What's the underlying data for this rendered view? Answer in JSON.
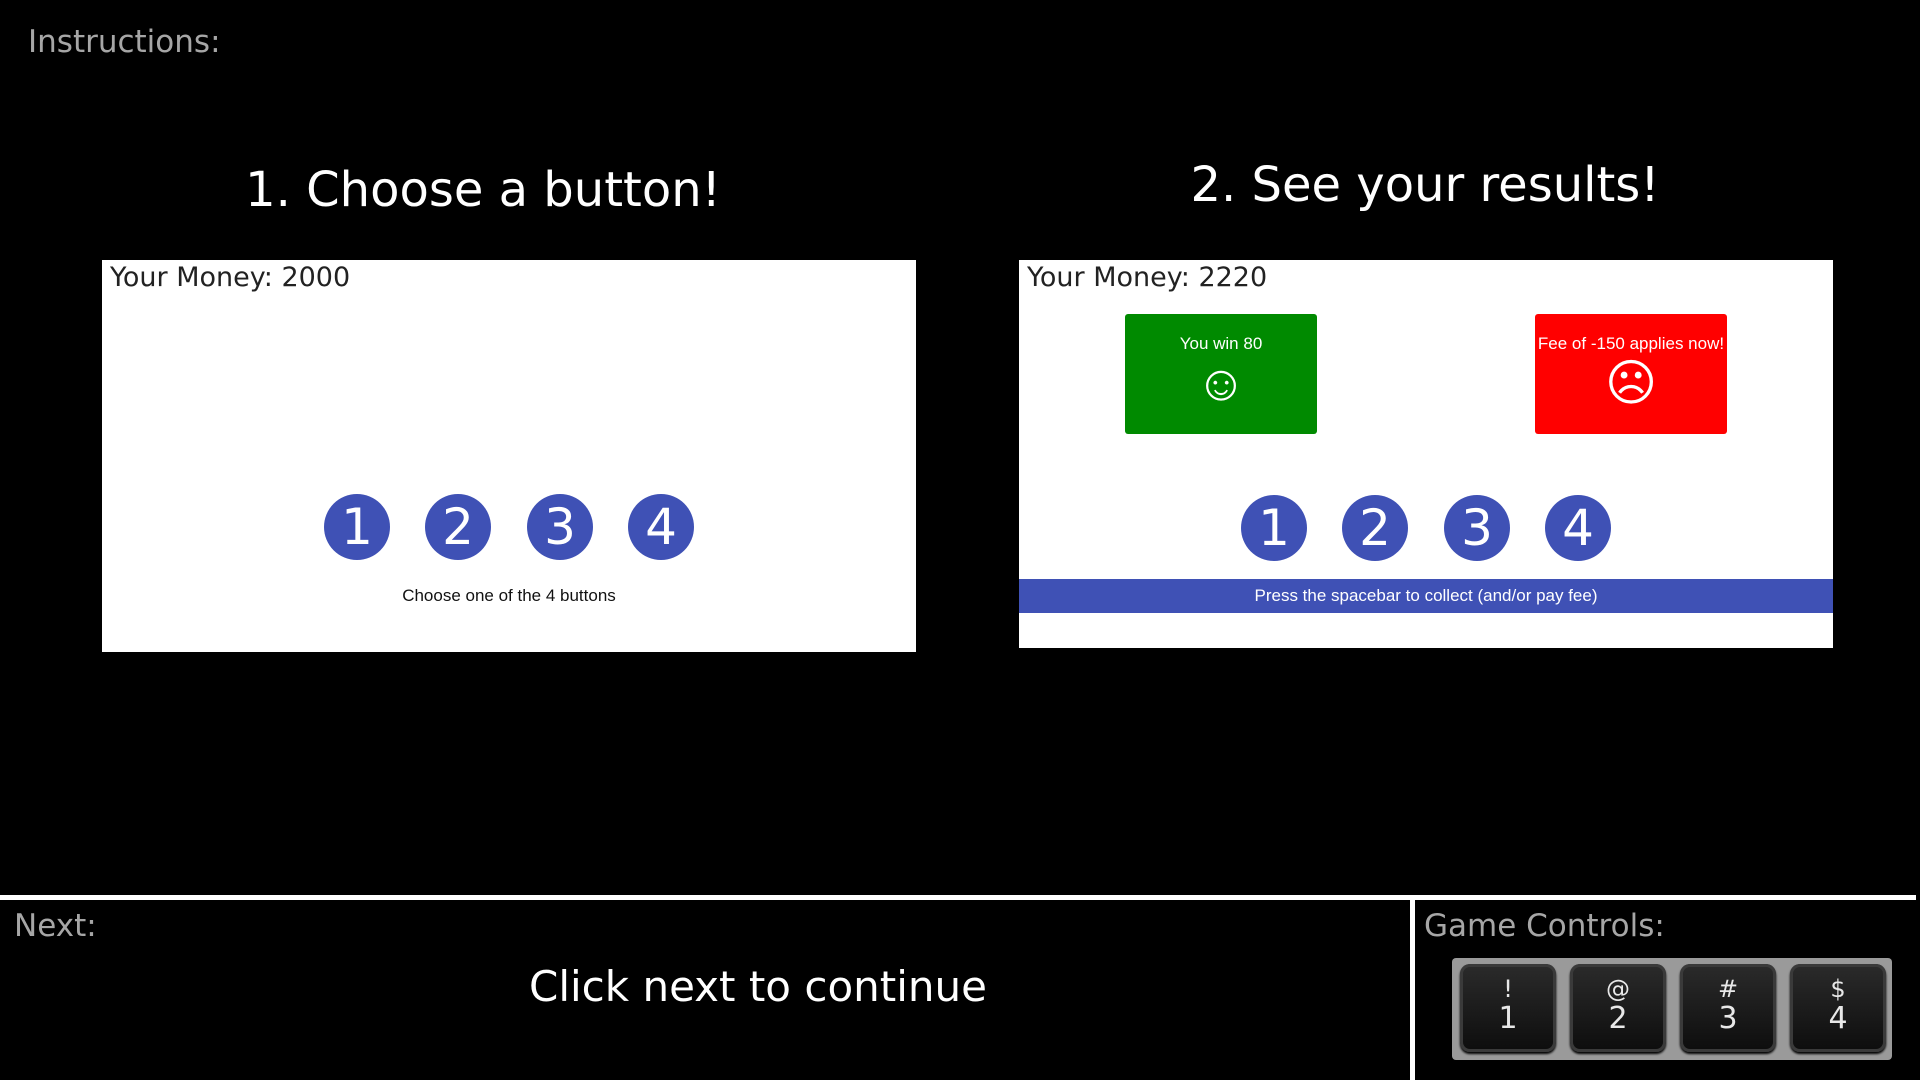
{
  "instructions_label": "Instructions:",
  "step1": {
    "title": "1. Choose a button!",
    "money_label": "Your Money: 2000",
    "buttons": [
      "1",
      "2",
      "3",
      "4"
    ],
    "hint": "Choose one of the 4 buttons"
  },
  "step2": {
    "title": "2. See your results!",
    "money_label": "Your Money: 2220",
    "win_card": {
      "text": "You win 80",
      "face": "☺",
      "color": "#008a00"
    },
    "fee_card": {
      "text": "Fee of -150 applies now!",
      "face": "☹",
      "color": "#ff0000"
    },
    "buttons": [
      "1",
      "2",
      "3",
      "4"
    ],
    "spacebar_prompt": "Press the spacebar to collect (and/or pay fee)"
  },
  "footer": {
    "next_label": "Next:",
    "next_text": "Click next to continue",
    "controls_label": "Game Controls:",
    "keys": [
      {
        "symbol": "!",
        "number": "1"
      },
      {
        "symbol": "@",
        "number": "2"
      },
      {
        "symbol": "#",
        "number": "3"
      },
      {
        "symbol": "$",
        "number": "4"
      }
    ]
  },
  "colors": {
    "accent": "#3f51b5",
    "background": "#000000",
    "label_gray": "#a6a6a6"
  }
}
